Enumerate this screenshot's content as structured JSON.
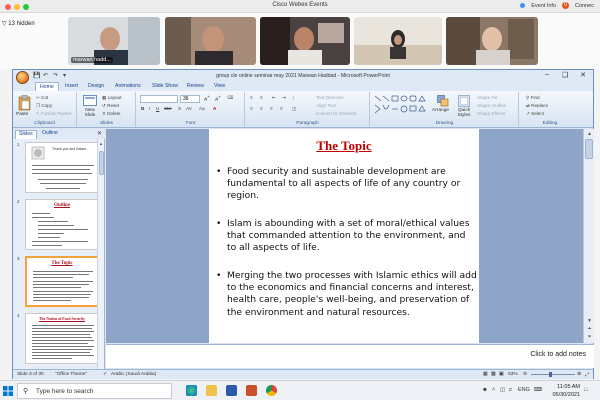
{
  "webex": {
    "title": "Cisco Webex Events",
    "hidden_label": "13 hidden",
    "event_info": "Event Info",
    "badge_count": "0",
    "connect_label": "Connec",
    "participants": [
      {
        "name": "marwan hadd..."
      },
      {
        "name": ""
      },
      {
        "name": ""
      },
      {
        "name": ""
      },
      {
        "name": ""
      }
    ]
  },
  "ppt": {
    "window_title": "group cle online seminar may 2021 Marwan Haddad  -  Microsoft PowerPoint",
    "tabs": [
      "Home",
      "Insert",
      "Design",
      "Animations",
      "Slide Show",
      "Review",
      "View"
    ],
    "ribbon": {
      "clipboard": {
        "paste": "Paste",
        "cut": "Cut",
        "copy": "Copy",
        "format_painter": "Format Painter",
        "label": "Clipboard"
      },
      "slides": {
        "new_slide": "New Slide",
        "layout": "Layout",
        "reset": "Reset",
        "delete": "Delete",
        "label": "Slides"
      },
      "font": {
        "size": "36",
        "label": "Font"
      },
      "paragraph": {
        "text_direction": "Text Direction",
        "align_text": "Align Text",
        "convert_smartart": "Convert to SmartArt",
        "label": "Paragraph"
      },
      "drawing": {
        "arrange": "Arrange",
        "quick_styles": "Quick Styles",
        "shape_fill": "Shape Fill",
        "shape_outline": "Shape Outline",
        "shape_effects": "Shape Effects",
        "label": "Drawing"
      },
      "editing": {
        "find": "Find",
        "replace": "Replace",
        "select": "Select",
        "label": "Editing"
      }
    },
    "panel_tabs": [
      "Slides",
      "Outline"
    ],
    "thumbnails": [
      {
        "num": "1",
        "title": "Thank you and Salam..."
      },
      {
        "num": "2",
        "title": "Outline"
      },
      {
        "num": "3",
        "title": "The Topic"
      },
      {
        "num": "4",
        "title": "The Notion of Food Security"
      }
    ],
    "slide": {
      "title": "The Topic",
      "bullets": [
        "Food security and sustainable development are fundamental to all aspects of life of any country or region.",
        "Islam is abounding with a set of moral/ethical values that commanded attention to the environment, and to all aspects of life.",
        "Merging the two processes with Islamic ethics will add to the economics and financial concerns and interest, health care, people's well-being, and preservation of the environment and natural resources."
      ]
    },
    "notes_placeholder": "Click to add notes",
    "status": {
      "slide_count": "Slide 3 of 30",
      "theme": "\"Office Theme\"",
      "language": "Arabic (Saudi Arabia)",
      "zoom": "53%"
    }
  },
  "taskbar": {
    "search_placeholder": "Type here to search",
    "language": "ENG",
    "time": "11:05 AM",
    "date": "05/30/2021"
  }
}
